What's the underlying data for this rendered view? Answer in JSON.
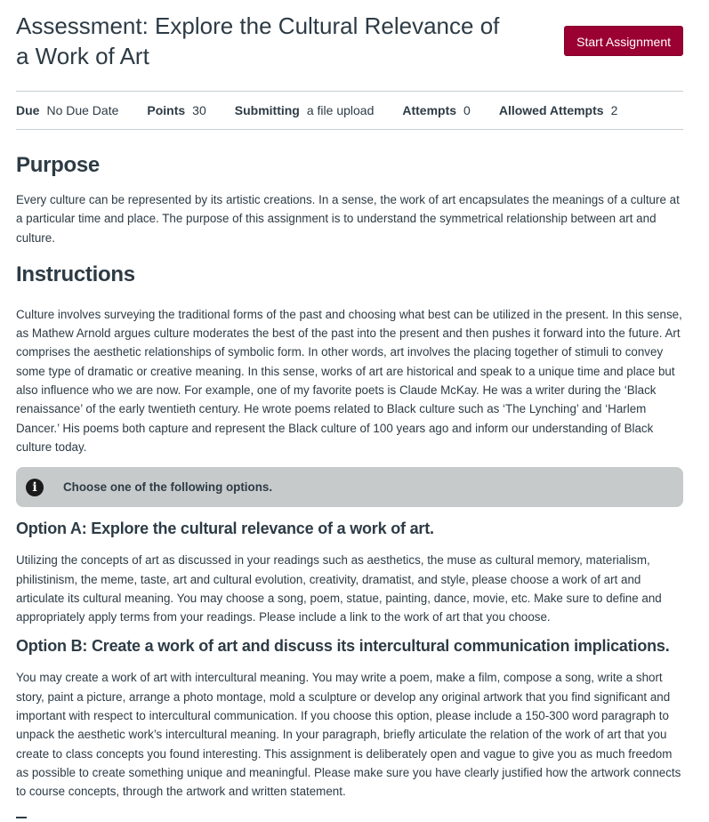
{
  "header": {
    "title": "Assessment: Explore the Cultural Relevance of a Work of Art",
    "start_button_label": "Start Assignment",
    "accent_color": "#9b0033"
  },
  "details": [
    {
      "label": "Due",
      "value": "No Due Date"
    },
    {
      "label": "Points",
      "value": "30"
    },
    {
      "label": "Submitting",
      "value": "a file upload"
    },
    {
      "label": "Attempts",
      "value": "0"
    },
    {
      "label": "Allowed Attempts",
      "value": "2"
    }
  ],
  "purpose": {
    "heading": "Purpose",
    "body": "Every culture can be represented by its artistic creations. In a sense, the work of art encapsulates the meanings of a culture at a particular time and place. The purpose of this assignment is to understand the symmetrical relationship between art and culture."
  },
  "instructions": {
    "heading": "Instructions",
    "body": "Culture involves surveying the traditional forms of the past and choosing what best can be utilized in the present. In this sense, as Mathew Arnold argues culture moderates the best of the past into the present and then pushes it forward into the future. Art comprises the aesthetic relationships of symbolic form. In other words, art involves the placing together of stimuli to convey some type of dramatic or creative meaning. In this sense, works of art are historical and speak to a unique time and place but also influence who we are now. For example, one of my favorite poets is Claude McKay. He was a writer during the ‘Black renaissance’ of the early twentieth century. He wrote poems related to Black culture such as ‘The Lynching’ and ‘Harlem Dancer.’ His poems both capture and represent the Black culture of 100 years ago and inform our understanding of Black culture today."
  },
  "callout": {
    "icon": "info-icon",
    "text": "Choose one of the following options."
  },
  "option_a": {
    "heading": "Option A: Explore the cultural relevance of a work of art.",
    "body": "Utilizing the concepts of art as discussed in your readings such as aesthetics, the muse as cultural memory, materialism, philistinism, the meme, taste, art and cultural evolution, creativity, dramatist, and style, please choose a work of art and articulate its cultural meaning. You may choose a song, poem, statue, painting, dance, movie, etc. Make sure to define and appropriately apply terms from your readings. Please include a link to the work of art that you choose."
  },
  "option_b": {
    "heading": "Option B: Create a work of art and discuss its intercultural communication implications.",
    "body": "You may create a work of art with intercultural meaning. You may write a poem, make a film, compose a song, write a short story, paint a picture, arrange a photo montage, mold a sculpture or develop any original artwork that you find significant and important with respect to intercultural communication. If you choose this option, please include a 150-300 word paragraph to unpack the aesthetic work’s intercultural meaning. In your paragraph, briefly articulate the relation of the work of art that you create to class concepts you found interesting. This assignment is deliberately open and vague to give you as much freedom as possible to create something unique and meaningful. Please make sure you have clearly justified how the artwork connects to course concepts, through the artwork and written statement."
  }
}
